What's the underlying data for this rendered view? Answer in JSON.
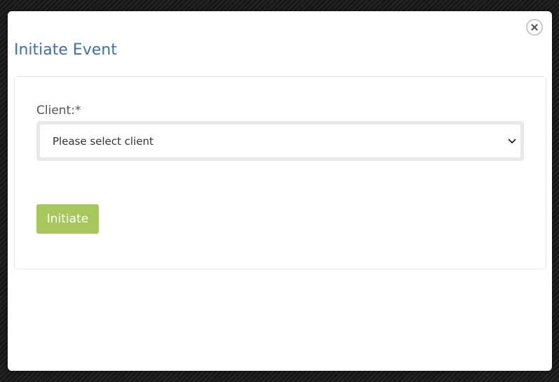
{
  "modal": {
    "title": "Initiate Event",
    "close_icon": "close-icon"
  },
  "form": {
    "client_label": "Client:*",
    "client_select": {
      "selected_text": "Please select client",
      "icon": "chevron-down-icon"
    },
    "submit_label": "Initiate"
  },
  "colors": {
    "title": "#3b72ae",
    "submit_button": "#a5c75b",
    "backdrop": "#1c1c1c"
  }
}
